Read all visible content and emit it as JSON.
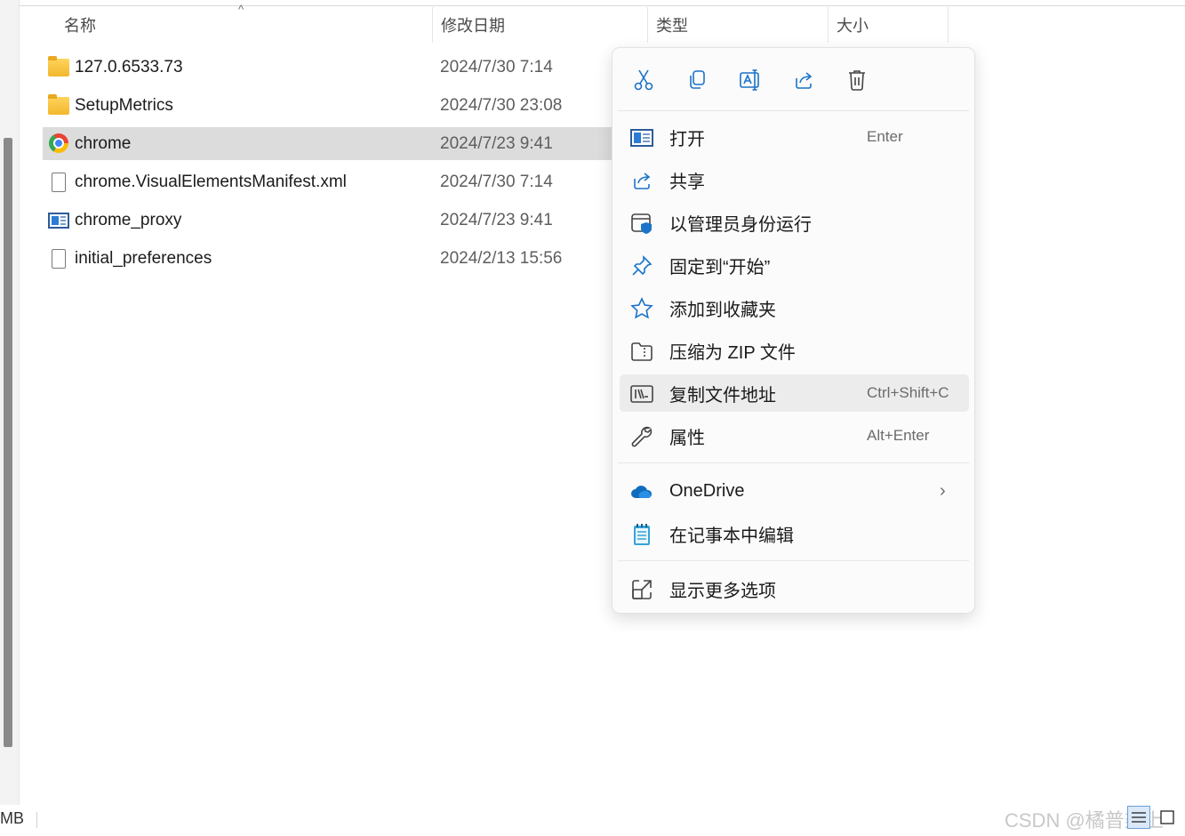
{
  "columns": {
    "name": "名称",
    "date_modified": "修改日期",
    "type": "类型",
    "size": "大小",
    "sort_indicator": "^"
  },
  "files": [
    {
      "name": "127.0.6533.73",
      "date": "2024/7/30 7:14",
      "icon": "folder-icon",
      "selected": false
    },
    {
      "name": "SetupMetrics",
      "date": "2024/7/30 23:08",
      "icon": "folder-icon",
      "selected": false
    },
    {
      "name": "chrome",
      "date": "2024/7/23 9:41",
      "icon": "chrome-icon",
      "selected": true
    },
    {
      "name": "chrome.VisualElementsManifest.xml",
      "date": "2024/7/30 7:14",
      "icon": "file-icon",
      "selected": false
    },
    {
      "name": "chrome_proxy",
      "date": "2024/7/23 9:41",
      "icon": "application-icon",
      "selected": false
    },
    {
      "name": "initial_preferences",
      "date": "2024/2/13 15:56",
      "icon": "file-icon",
      "selected": false
    }
  ],
  "context_menu": {
    "toolbar": [
      {
        "icon": "cut-icon"
      },
      {
        "icon": "copy-icon"
      },
      {
        "icon": "rename-icon"
      },
      {
        "icon": "share-icon"
      },
      {
        "icon": "delete-icon"
      }
    ],
    "items": [
      {
        "label": "打开",
        "shortcut": "Enter",
        "icon": "open-app-icon"
      },
      {
        "label": "共享",
        "shortcut": "",
        "icon": "share-icon"
      },
      {
        "label": "以管理员身份运行",
        "shortcut": "",
        "icon": "shield-icon"
      },
      {
        "label": "固定到“开始”",
        "shortcut": "",
        "icon": "pin-icon"
      },
      {
        "label": "添加到收藏夹",
        "shortcut": "",
        "icon": "star-icon"
      },
      {
        "label": "压缩为 ZIP 文件",
        "shortcut": "",
        "icon": "zip-icon"
      },
      {
        "label": "复制文件地址",
        "shortcut": "Ctrl+Shift+C",
        "icon": "copy-path-icon"
      },
      {
        "label": "属性",
        "shortcut": "Alt+Enter",
        "icon": "wrench-icon"
      },
      {
        "label": "OneDrive",
        "shortcut": "",
        "icon": "onedrive-icon",
        "submenu": true
      },
      {
        "label": "在记事本中编辑",
        "shortcut": "",
        "icon": "notepad-icon"
      },
      {
        "label": "显示更多选项",
        "shortcut": "",
        "icon": "more-options-icon"
      }
    ],
    "hovered_item": "复制文件地址"
  },
  "status_bar": {
    "size_fragment": "MB",
    "watermark": "CSDN @橘普柒上"
  },
  "colors": {
    "selection": "#dcdcdc",
    "accent_blue": "#1a73c8",
    "menu_bg": "#fbfbfb"
  }
}
